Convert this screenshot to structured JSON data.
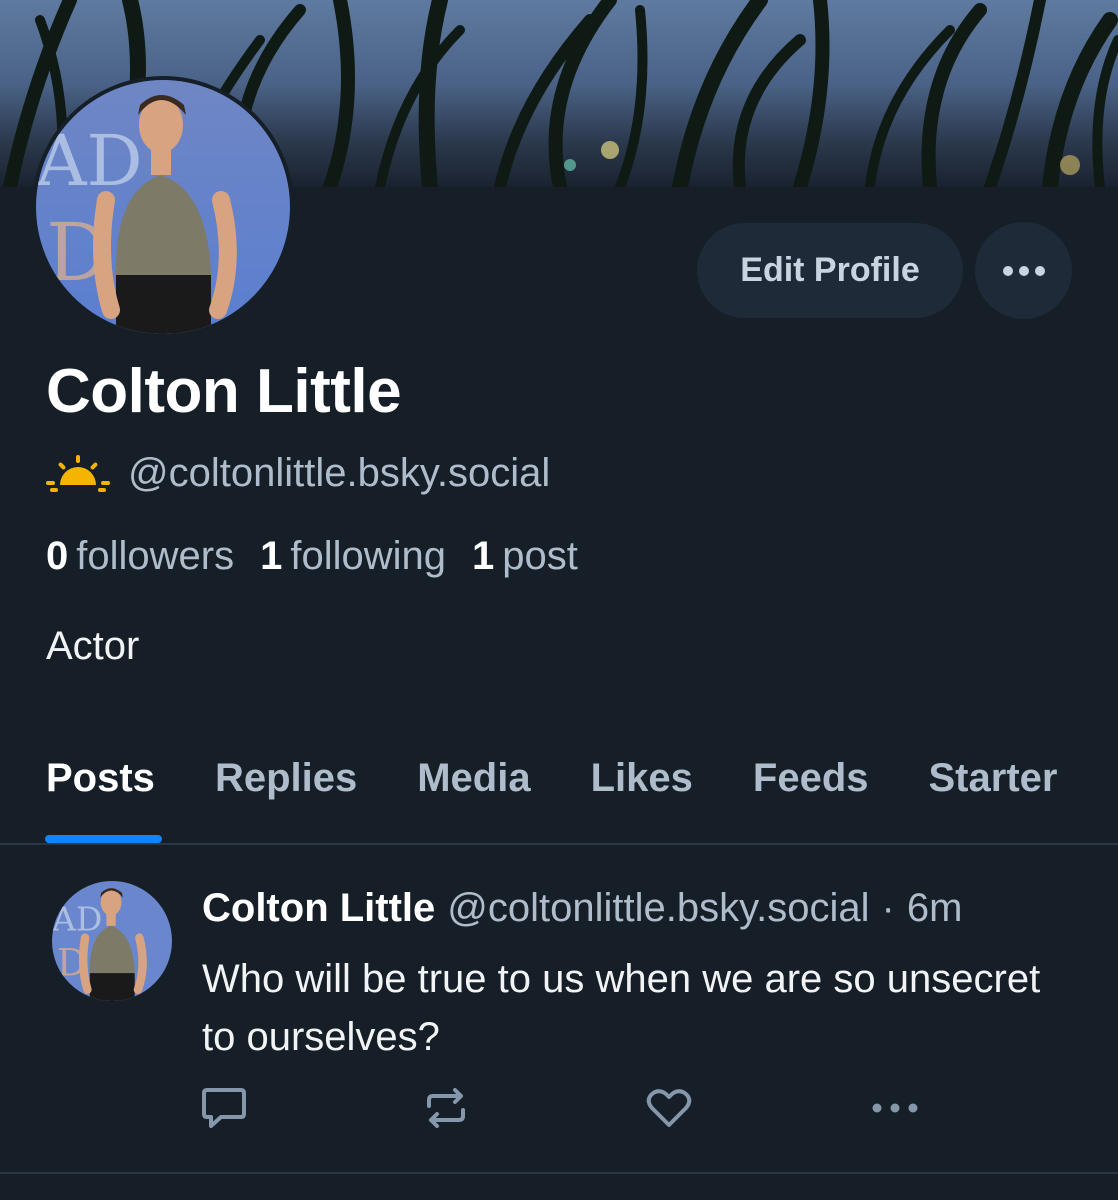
{
  "profile": {
    "display_name": "Colton Little",
    "handle": "@coltonlittle.bsky.social",
    "bio": "Actor",
    "handle_icon": "sun-icon",
    "stats": {
      "followers_count": "0",
      "followers_label": "followers",
      "following_count": "1",
      "following_label": "following",
      "posts_count": "1",
      "posts_label": "post"
    }
  },
  "actions": {
    "edit_profile_label": "Edit Profile",
    "more_icon": "more-horizontal-icon"
  },
  "tabs": [
    {
      "label": "Posts",
      "active": true
    },
    {
      "label": "Replies",
      "active": false
    },
    {
      "label": "Media",
      "active": false
    },
    {
      "label": "Likes",
      "active": false
    },
    {
      "label": "Feeds",
      "active": false
    },
    {
      "label": "Starter",
      "active": false
    }
  ],
  "posts": [
    {
      "author_name": "Colton Little",
      "author_handle": "@coltonlittle.bsky.social",
      "separator": "·",
      "time": "6m",
      "text": "Who will be true to us when we are so unsecret to ourselves?",
      "action_icons": [
        "reply-icon",
        "repost-icon",
        "like-icon",
        "more-icon"
      ]
    }
  ],
  "colors": {
    "background": "#161e27",
    "accent": "#1185fe",
    "muted_text": "#aebccb",
    "button_bg": "#1e2a38"
  }
}
